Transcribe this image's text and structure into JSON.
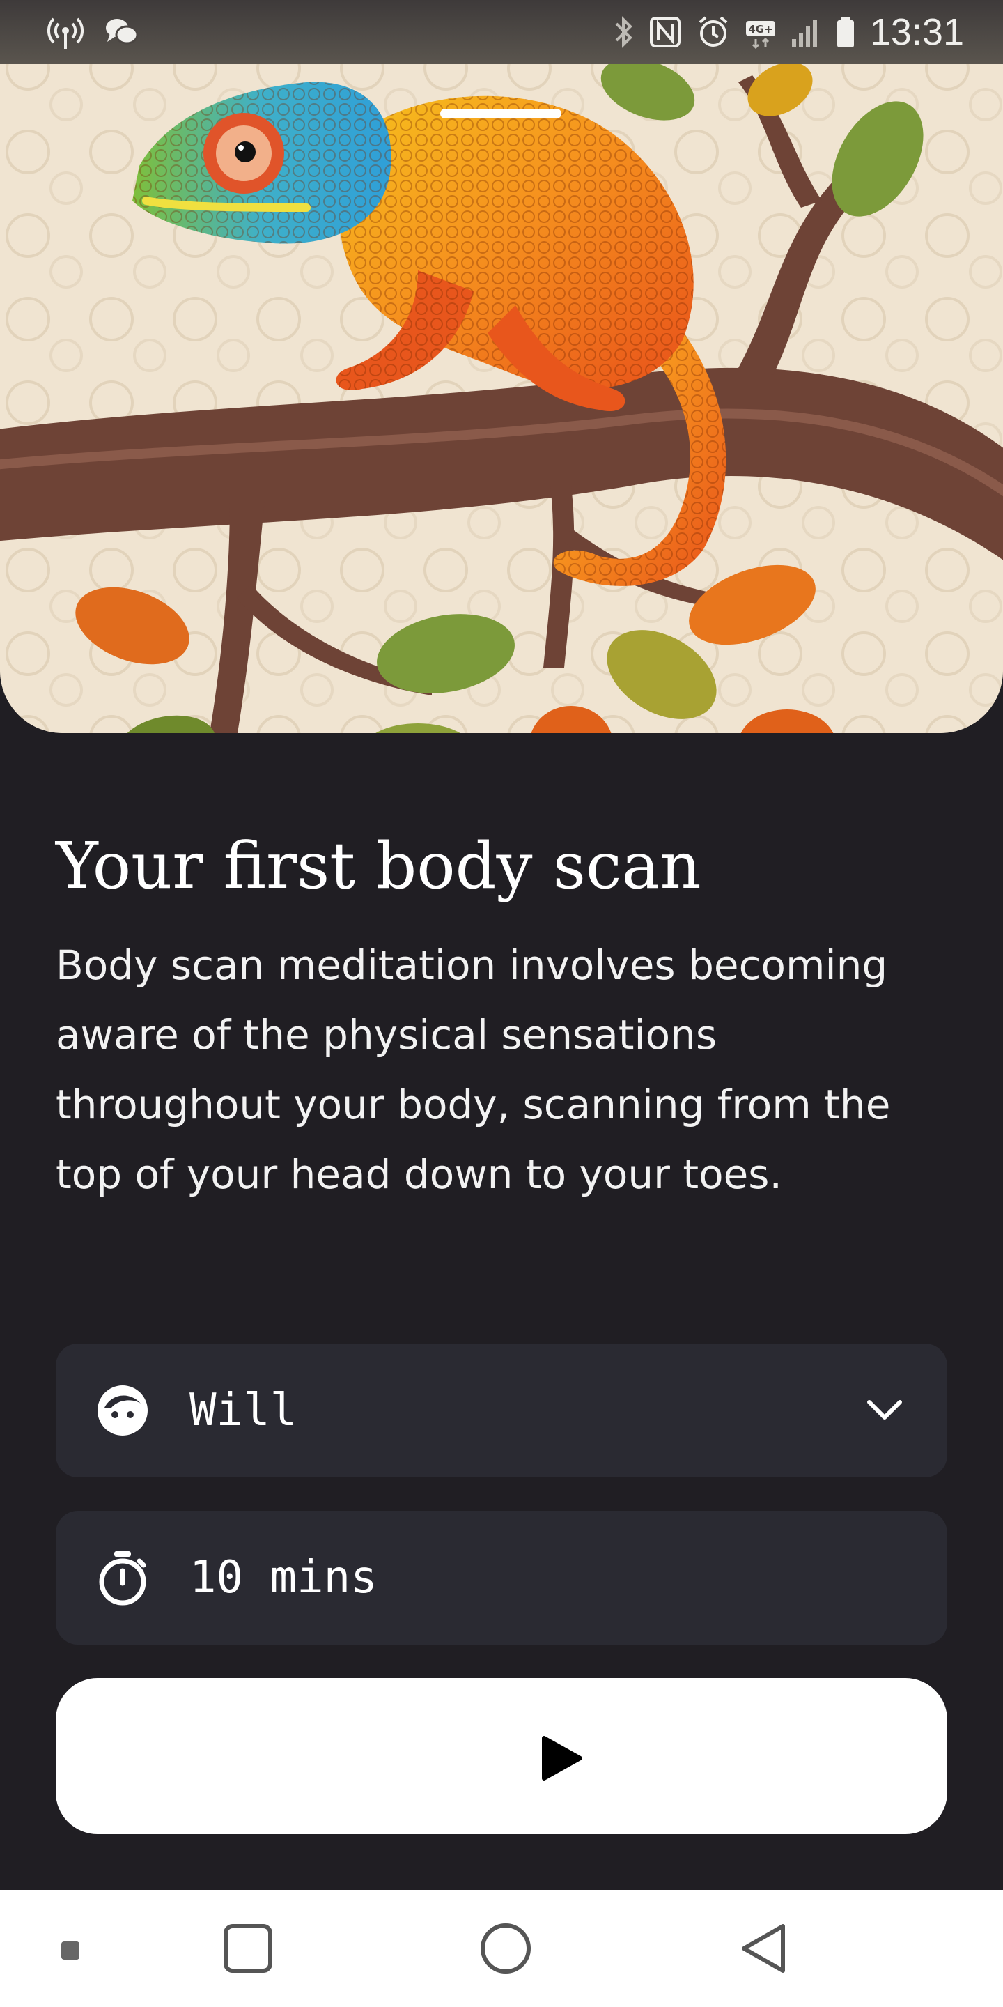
{
  "status_bar": {
    "time": "13:31",
    "network_badge": "4G+",
    "left_icons": [
      "hotspot-icon",
      "messenger-bubbles-icon"
    ],
    "right_icons": [
      "bluetooth-icon",
      "nfc-icon",
      "alarm-icon",
      "network-4g-icon",
      "signal-icon",
      "battery-icon"
    ]
  },
  "hero": {
    "image": "chameleon-on-branch-illustration"
  },
  "session": {
    "title": "Your first body scan",
    "description": "Body scan meditation involves becoming aware of the physical sensations throughout your body, scanning from the top of your head down to your toes."
  },
  "voice": {
    "icon": "face-icon",
    "selected": "Will",
    "dropdown_icon": "chevron-down-icon"
  },
  "duration": {
    "icon": "stopwatch-icon",
    "value": "10 mins"
  },
  "play": {
    "icon": "play-icon"
  },
  "nav_bar": {
    "items": [
      "recents-dot-icon",
      "overview-square-icon",
      "home-circle-icon",
      "back-triangle-icon"
    ]
  },
  "colors": {
    "background": "#201e23",
    "card": "#2a2a32",
    "play_button": "#ffffff",
    "text": "#ffffff"
  }
}
